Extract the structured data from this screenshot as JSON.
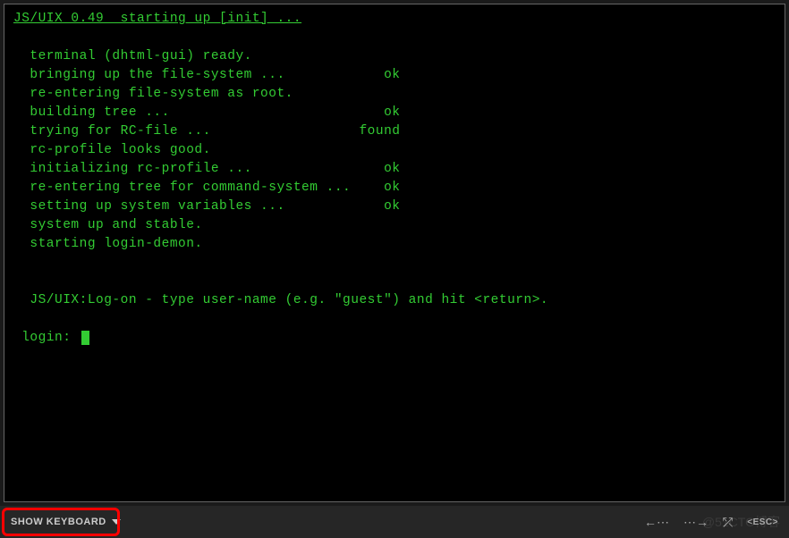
{
  "terminal": {
    "title_line": "JS/UIX 0.49  starting up [init] ...",
    "lines": [
      "",
      "  terminal (dhtml-gui) ready.",
      "  bringing up the file-system ...            ok",
      "  re-entering file-system as root.",
      "  building tree ...                          ok",
      "  trying for RC-file ...                  found",
      "  rc-profile looks good.",
      "  initializing rc-profile ...                ok",
      "  re-entering tree for command-system ...    ok",
      "  setting up system variables ...            ok",
      "  system up and stable.",
      "  starting login-demon.",
      "",
      "",
      "  JS/UIX:Log-on - type user-name (e.g. \"guest\") and hit <return>.",
      ""
    ],
    "prompt": " login: "
  },
  "statusbar": {
    "show_keyboard_label": "SHOW KEYBOARD",
    "back_arrow": "←⋯",
    "forward_arrow": "⋯→",
    "cross_arrows": "⤱",
    "esc_label": "<ESC>"
  },
  "watermark": "@51CTO博客"
}
